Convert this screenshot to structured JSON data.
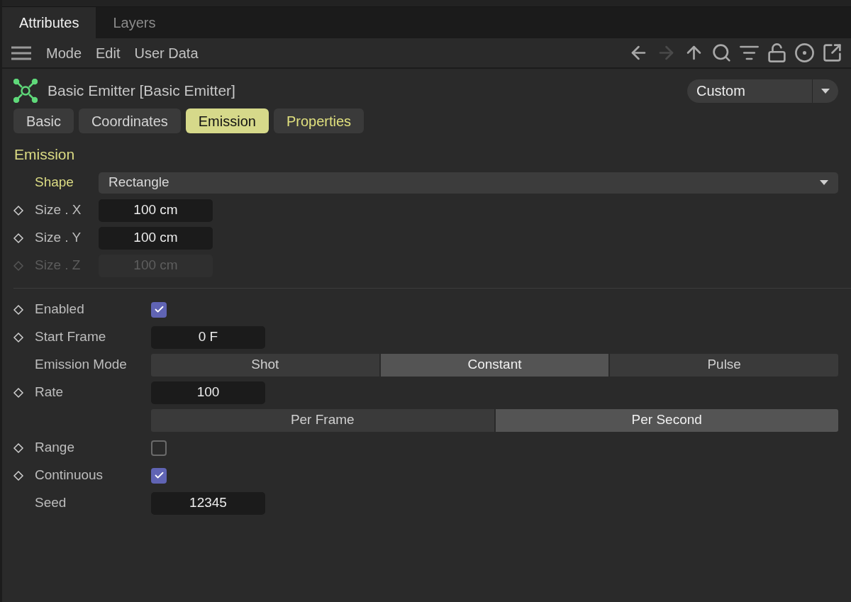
{
  "panel_tabs": [
    {
      "label": "Attributes",
      "selected": true
    },
    {
      "label": "Layers",
      "selected": false
    }
  ],
  "menu": [
    "Mode",
    "Edit",
    "User Data"
  ],
  "toolbar_buttons": [
    {
      "kind": "back",
      "disabled": false
    },
    {
      "kind": "forward",
      "disabled": true
    },
    {
      "kind": "up",
      "disabled": false
    },
    {
      "kind": "search",
      "disabled": false
    },
    {
      "kind": "filter",
      "disabled": false
    },
    {
      "kind": "lock",
      "disabled": false
    },
    {
      "kind": "target",
      "disabled": false
    },
    {
      "kind": "popout",
      "disabled": false
    }
  ],
  "object": {
    "title": "Basic Emitter [Basic Emitter]",
    "preset": "Custom"
  },
  "tabs": [
    {
      "label": "Basic",
      "selected": false,
      "highlighted": false
    },
    {
      "label": "Coordinates",
      "selected": false,
      "highlighted": false
    },
    {
      "label": "Emission",
      "selected": true,
      "highlighted": true
    },
    {
      "label": "Properties",
      "selected": false,
      "highlighted": true
    }
  ],
  "section_title": "Emission",
  "groups": [
    {
      "rows": [
        {
          "kind": "dropdown",
          "label": "Shape",
          "keyframe": false,
          "highlighted": true,
          "value": "Rectangle"
        },
        {
          "kind": "field",
          "label": "Size . X",
          "keyframe": true,
          "disabled": false,
          "value": "100 cm"
        },
        {
          "kind": "field",
          "label": "Size . Y",
          "keyframe": true,
          "disabled": false,
          "value": "100 cm"
        },
        {
          "kind": "field",
          "label": "Size . Z",
          "keyframe": true,
          "disabled": true,
          "value": "100 cm"
        }
      ]
    },
    {
      "rows": [
        {
          "kind": "checkbox",
          "label": "Enabled",
          "keyframe": true,
          "checked": true
        },
        {
          "kind": "field",
          "label": "Start Frame",
          "keyframe": true,
          "disabled": false,
          "value": "0 F"
        },
        {
          "kind": "segmented",
          "label": "Emission Mode",
          "keyframe": false,
          "options": [
            {
              "label": "Shot",
              "selected": false
            },
            {
              "label": "Constant",
              "selected": true
            },
            {
              "label": "Pulse",
              "selected": false
            }
          ]
        },
        {
          "kind": "field",
          "label": "Rate",
          "keyframe": true,
          "disabled": false,
          "value": "100"
        },
        {
          "kind": "segmented",
          "keyframe": false,
          "options": [
            {
              "label": "Per Frame",
              "selected": false
            },
            {
              "label": "Per Second",
              "selected": true
            }
          ]
        },
        {
          "kind": "checkbox",
          "label": "Range",
          "keyframe": true,
          "checked": false
        },
        {
          "kind": "checkbox",
          "label": "Continuous",
          "keyframe": true,
          "checked": true
        },
        {
          "kind": "field",
          "label": "Seed",
          "keyframe": false,
          "disabled": false,
          "value": "12345"
        }
      ]
    }
  ]
}
